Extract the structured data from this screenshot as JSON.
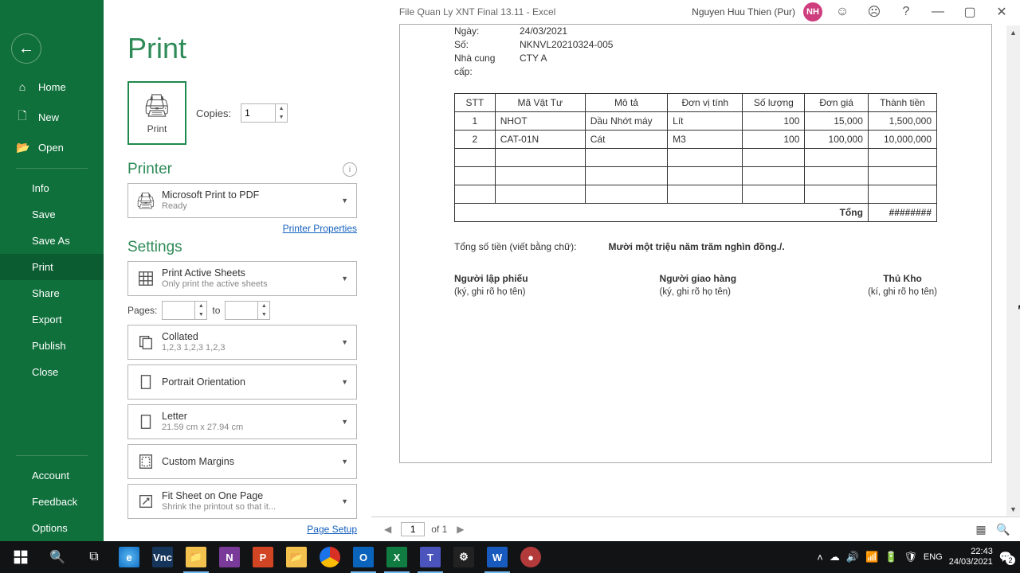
{
  "titlebar": {
    "filename": "File Quan Ly XNT Final 13.11  -  Excel",
    "username": "Nguyen Huu Thien (Pur)",
    "avatar": "NH"
  },
  "sidebar": {
    "home": "Home",
    "new": "New",
    "open": "Open",
    "info": "Info",
    "save": "Save",
    "saveas": "Save As",
    "print": "Print",
    "share": "Share",
    "export": "Export",
    "publish": "Publish",
    "close": "Close",
    "account": "Account",
    "feedback": "Feedback",
    "options": "Options"
  },
  "panel": {
    "title": "Print",
    "printbtn": "Print",
    "copies_label": "Copies:",
    "copies_value": "1",
    "printer_label": "Printer",
    "printer_name": "Microsoft Print to PDF",
    "printer_status": "Ready",
    "printer_props": "Printer Properties",
    "settings_label": "Settings",
    "what_main": "Print Active Sheets",
    "what_sub": "Only print the active sheets",
    "pages_label": "Pages:",
    "pages_from": "",
    "pages_to_label": "to",
    "pages_to": "",
    "collate_main": "Collated",
    "collate_sub": "1,2,3    1,2,3    1,2,3",
    "orient": "Portrait Orientation",
    "paper_main": "Letter",
    "paper_sub": "21.59 cm x 27.94 cm",
    "margins": "Custom Margins",
    "scale_main": "Fit Sheet on One Page",
    "scale_sub": "Shrink the printout so that it...",
    "page_setup": "Page Setup"
  },
  "doc": {
    "ngay_lab": "Ngày:",
    "ngay": "24/03/2021",
    "so_lab": "Số:",
    "so": "NKNVL20210324-005",
    "ncc_lab": "Nhà cung cấp:",
    "ncc": "CTY A",
    "headers": {
      "stt": "STT",
      "ma": "Mã Vật Tư",
      "mota": "Mô tả",
      "dvt": "Đơn vị tính",
      "sl": "Số lượng",
      "dg": "Đơn giá",
      "tt": "Thành tiền"
    },
    "rows": [
      {
        "stt": "1",
        "ma": "NHOT",
        "mota": "Dầu Nhớt máy",
        "dvt": "Lít",
        "sl": "100",
        "dg": "15,000",
        "tt": "1,500,000"
      },
      {
        "stt": "2",
        "ma": "CAT-01N",
        "mota": "Cát",
        "dvt": "M3",
        "sl": "100",
        "dg": "100,000",
        "tt": "10,000,000"
      }
    ],
    "tong": "Tổng",
    "tong_val": "########",
    "total_lab": "Tổng số tiền (viết bằng chữ):",
    "total_txt": "Mười một triệu năm trăm nghìn đồng./.",
    "sig1": "Người lập phiếu",
    "sig2": "Người giao hàng",
    "sig3": "Thủ Kho",
    "sign": "(ký, ghi rõ họ tên)",
    "sign3": "(kí, ghi rõ họ tên)"
  },
  "footer": {
    "page": "1",
    "of": "of 1"
  },
  "tray": {
    "lang": "ENG",
    "time": "22:43",
    "date": "24/03/2021",
    "notif": "2"
  }
}
